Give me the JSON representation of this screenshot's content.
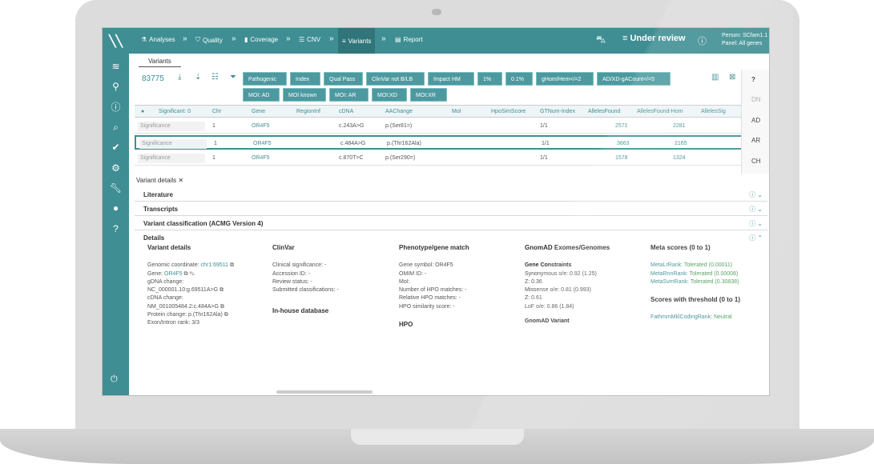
{
  "nav": {
    "crumbs": [
      "Analyses",
      "Quality",
      "Coverage",
      "CNV",
      "Variants",
      "Report"
    ],
    "status": "Under review",
    "person": "Person: SCfam1.1",
    "panel": "Panel: All genes"
  },
  "variants_tab": "Variants",
  "variant_count": "83775",
  "filters_row1": [
    "Pathogenic",
    "Index",
    "Qual Pass",
    "ClinVar not B/LB",
    "Impact HM",
    "1%",
    "0.1%",
    "gHom/Hem</=2",
    "AD/XD-gACount</=5"
  ],
  "filters_row2": [
    "MOI: AD",
    "MOI known",
    "MOI: AR",
    "MOI:XD",
    "MOI:XR"
  ],
  "columns": [
    "Significant: 0",
    "Chr",
    "Gene",
    "RegionInf",
    "cDNA",
    "AAChange",
    "MoI",
    "HpoSimScore",
    "GTNum-Index",
    "AllelesFound",
    "AllelesFound-Hom",
    "AllelesSig"
  ],
  "rows": [
    {
      "sig": "Significance",
      "chr": "1",
      "gene": "OR4F5",
      "cdna": "c.243A>G",
      "aa": "p.(Ser81=)",
      "gt": "1/1",
      "af": "2571",
      "afh": "2281"
    },
    {
      "sig": "Significance",
      "chr": "1",
      "gene": "OR4F5",
      "cdna": "c.484A>G",
      "aa": "p.(Thr162Ala)",
      "gt": "1/1",
      "af": "3663",
      "afh": "2165"
    },
    {
      "sig": "Significance",
      "chr": "1",
      "gene": "OR4F5",
      "cdna": "c.870T>C",
      "aa": "p.(Ser290=)",
      "gt": "1/1",
      "af": "1578",
      "afh": "1324"
    }
  ],
  "moi_options": [
    "DN",
    "AD",
    "AR",
    "CH"
  ],
  "variant_details_tab": "Variant details",
  "accordions": [
    "Literature",
    "Transcripts",
    "Variant classification (ACMG Version 4)",
    "Details"
  ],
  "details": {
    "variant": {
      "title": "Variant details",
      "genomic": "Genomic coordinate:",
      "genomic_val": "chr1:69511",
      "gene": "Gene:",
      "gene_val": "OR4F5",
      "gdna": "gDNA change:",
      "gdna_val": "NC_000001.10:g.69511A>G",
      "cdna": "cDNA change:",
      "cdna_val": "NM_001005484.2:c.484A>G",
      "protein": "Protein change: p.(Thr162Ala)",
      "exon": "Exon/Intron rank: 3/3"
    },
    "clinvar": {
      "title": "ClinVar",
      "lines": [
        "Clinical significance: -",
        "Accession ID: -",
        "Review status: -",
        "Submitted classifications: -"
      ],
      "inhouse": "In-house database"
    },
    "phenotype": {
      "title": "Phenotype/gene match",
      "lines": [
        "Gene symbol: OR4F5",
        "OMIM ID: -",
        "MoI:",
        "Number of HPO matches: -",
        "Relative HPO matches: -",
        "HPO similarity score: -"
      ],
      "hpo": "HPO"
    },
    "gnomad": {
      "title": "GnomAD Exomes/Genomes",
      "sub": "Gene Constraints",
      "lines": [
        "Synonymous o/e: 0.92 (1.25)",
        "Z: 0.36",
        "Missense o/e: 0.81 (0.993)",
        "Z: 0.61",
        "LoF o/e: 0.86 (1.84)"
      ],
      "variant": "GnomAD Variant"
    },
    "meta": {
      "title": "Meta scores (0 to 1)",
      "lines": [
        [
          "MetaLrRank:",
          "Tolerated (0.00011)"
        ],
        [
          "MetaRnnRank:",
          "Tolerated (0.00008)"
        ],
        [
          "MetaSvmRank:",
          "Tolerated (0.30838)"
        ]
      ],
      "threshold": "Scores with threshold (0 to 1)",
      "fathmm": [
        "FathmmMklCodingRank:",
        "Neutral"
      ]
    }
  }
}
